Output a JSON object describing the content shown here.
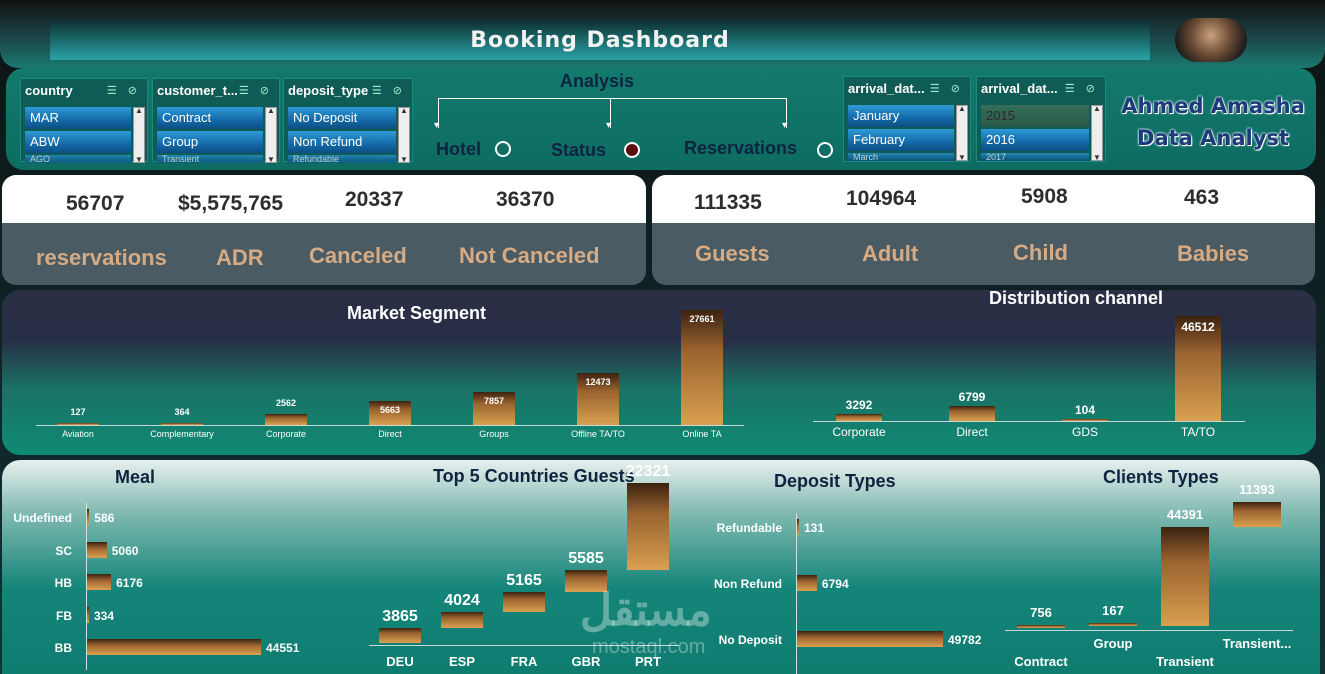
{
  "header": {
    "title": "Booking Dashboard"
  },
  "slicers": {
    "country": {
      "title": "country",
      "items": [
        "MAR",
        "ABW",
        "AGO"
      ]
    },
    "customer_type": {
      "title": "customer_t...",
      "items": [
        "Contract",
        "Group",
        "Transient"
      ]
    },
    "deposit_type": {
      "title": "deposit_type",
      "items": [
        "No Deposit",
        "Non Refund",
        "Refundable"
      ]
    },
    "arrival_month": {
      "title": "arrival_dat...",
      "items": [
        "January",
        "February",
        "March"
      ]
    },
    "arrival_year": {
      "title": "arrival_dat...",
      "items": [
        "2015",
        "2016",
        "2017"
      ]
    }
  },
  "analysis": {
    "title": "Analysis",
    "options": [
      {
        "label": "Hotel",
        "selected": false
      },
      {
        "label": "Status",
        "selected": true
      },
      {
        "label": "Reservations",
        "selected": false
      }
    ]
  },
  "brand": {
    "line1": "Ahmed Amasha",
    "line2": "Data Analyst"
  },
  "kpis_left": [
    {
      "value": "56707",
      "label": "reservations"
    },
    {
      "value": "$5,575,765",
      "label": "ADR"
    },
    {
      "value": "20337",
      "label": "Canceled"
    },
    {
      "value": "36370",
      "label": "Not Canceled"
    }
  ],
  "kpis_right": [
    {
      "value": "111335",
      "label": "Guests"
    },
    {
      "value": "104964",
      "label": "Adult"
    },
    {
      "value": "5908",
      "label": "Child"
    },
    {
      "value": "463",
      "label": "Babies"
    }
  ],
  "colors": {
    "bar_top": "#3b2310",
    "bar_bottom": "#d9a050",
    "teal": "#0f7c70",
    "kpi_label": "#d6ab84"
  },
  "chart_data": [
    {
      "type": "bar",
      "title": "Market Segment",
      "categories": [
        "Aviation",
        "Complementary",
        "Corporate",
        "Direct",
        "Groups",
        "Offline TA/TO",
        "Online TA"
      ],
      "values": [
        127,
        364,
        2562,
        5663,
        7857,
        12473,
        27661
      ]
    },
    {
      "type": "bar",
      "title": "Distribution channel",
      "categories": [
        "Corporate",
        "Direct",
        "GDS",
        "TA/TO"
      ],
      "values": [
        3292,
        6799,
        104,
        46512
      ]
    },
    {
      "type": "bar",
      "orientation": "horizontal",
      "title": "Meal",
      "categories": [
        "Undefined",
        "SC",
        "HB",
        "FB",
        "BB"
      ],
      "values": [
        586,
        5060,
        6176,
        334,
        44551
      ]
    },
    {
      "type": "bar",
      "subtype": "waterfall",
      "title": "Top 5 Countries Guests",
      "categories": [
        "DEU",
        "ESP",
        "FRA",
        "GBR",
        "PRT"
      ],
      "values": [
        3865,
        4024,
        5165,
        5585,
        22321
      ]
    },
    {
      "type": "bar",
      "orientation": "horizontal",
      "title": "Deposit Types",
      "categories": [
        "Refundable",
        "Non Refund",
        "No Deposit"
      ],
      "values": [
        131,
        6794,
        49782
      ]
    },
    {
      "type": "bar",
      "subtype": "waterfall",
      "title": "Clients Types",
      "categories": [
        "Contract",
        "Group",
        "Transient",
        "Transient..."
      ],
      "values": [
        756,
        167,
        44391,
        11393
      ]
    }
  ],
  "watermark": {
    "arabic": "مستقل",
    "latin": "mostaql.com"
  }
}
